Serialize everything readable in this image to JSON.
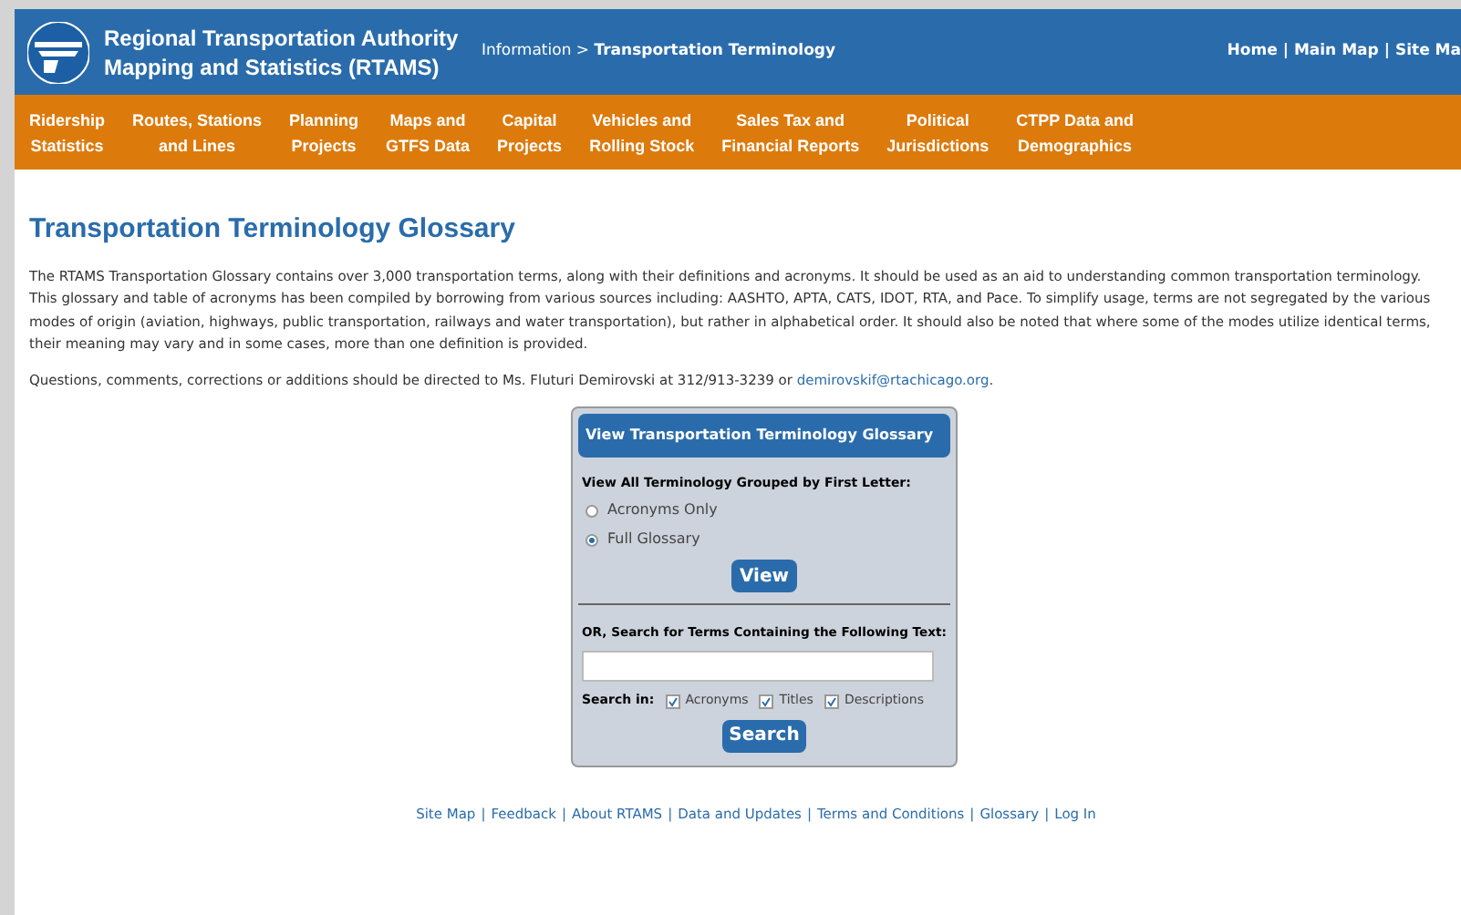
{
  "header": {
    "title_line1": "Regional Transportation Authority",
    "title_line2": "Mapping and Statistics (RTAMS)",
    "breadcrumb": {
      "parent": "Information",
      "separator": ">",
      "current": "Transportation Terminology"
    },
    "links": [
      {
        "label": "Home"
      },
      {
        "separator": "|",
        "label": "Main Map"
      },
      {
        "separator": "|",
        "label": "Site Ma"
      }
    ]
  },
  "nav": [
    {
      "line1": "Ridership",
      "line2": "Statistics"
    },
    {
      "line1": "Routes, Stations",
      "line2": "and Lines"
    },
    {
      "line1": "Planning",
      "line2": "Projects"
    },
    {
      "line1": "Maps and",
      "line2": "GTFS Data"
    },
    {
      "line1": "Capital",
      "line2": "Projects"
    },
    {
      "line1": "Vehicles and",
      "line2": "Rolling Stock"
    },
    {
      "line1": "Sales Tax and",
      "line2": "Financial Reports"
    },
    {
      "line1": "Political",
      "line2": "Jurisdictions"
    },
    {
      "line1": "CTPP Data and",
      "line2": "Demographics"
    }
  ],
  "page_title": "Transportation Terminology Glossary",
  "intro": "The RTAMS Transportation Glossary contains over 3,000 transportation terms, along with their definitions and acronyms. It should be used as an aid to understanding common transportation terminology. This glossary and table of acronyms has been compiled by borrowing from various sources including: AASHTO, APTA, CATS, IDOT, RTA, and Pace. To simplify usage, terms are not segregated by the various modes of origin (aviation, highways, public transportation, railways and water transportation), but rather in alphabetical order. It should also be noted that where some of the modes utilize identical terms, their meaning may vary and in some cases, more than one definition is provided.",
  "contact": {
    "text": "Questions, comments, corrections or additions should be directed to Ms. Fluturi Demirovski at 312/913-3239 or",
    "email": "demirovskif@rtachicago.org",
    "end": "."
  },
  "panel": {
    "title": "View Transportation Terminology Glossary",
    "group_label": "View All Terminology Grouped by First Letter:",
    "options": [
      {
        "label": "Acronyms Only",
        "selected": false
      },
      {
        "label": "Full Glossary",
        "selected": true
      }
    ],
    "view_button": "View",
    "search_label": "OR, Search for Terms Containing the Following Text:",
    "search_in_label": "Search in:",
    "search_in": [
      {
        "label": "Acronyms",
        "checked": true
      },
      {
        "label": "Titles",
        "checked": true
      },
      {
        "label": "Descriptions",
        "checked": true
      }
    ],
    "search_button": "Search"
  },
  "footer_links": [
    {
      "label": "Site Map"
    },
    {
      "separator": "|",
      "label": "Feedback"
    },
    {
      "separator": "|",
      "label": "About RTAMS"
    },
    {
      "separator": "|",
      "label": "Data and Updates"
    },
    {
      "separator": "|",
      "label": "Terms and Conditions"
    },
    {
      "separator": "|",
      "label": "Glossary"
    },
    {
      "separator": "|",
      "label": "Log In"
    }
  ]
}
